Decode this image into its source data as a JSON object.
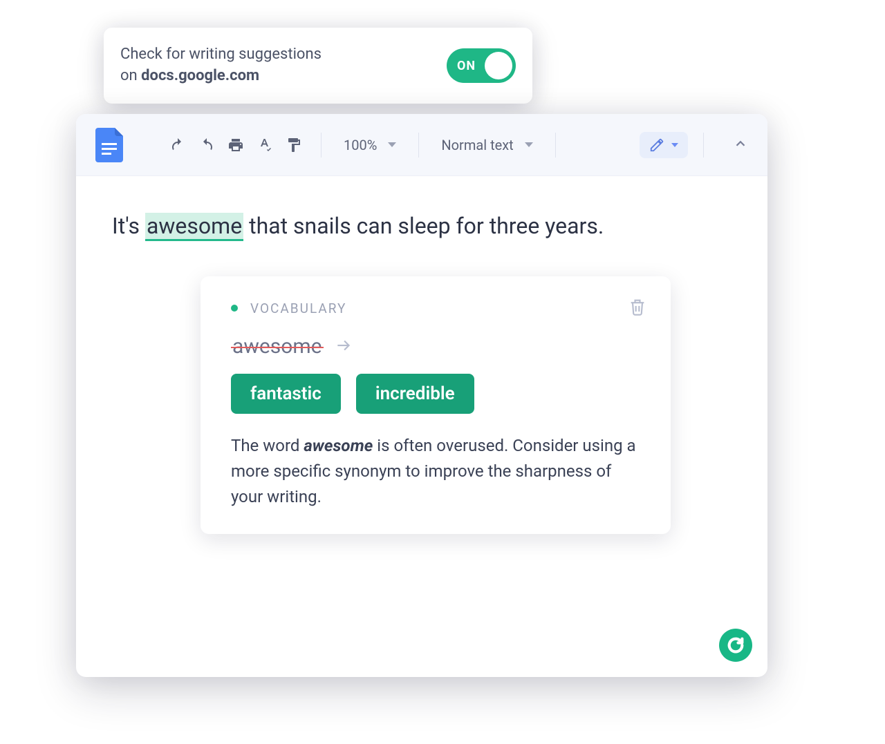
{
  "settings": {
    "text_line1": "Check for writing suggestions",
    "text_line2_prefix": "on ",
    "domain": "docs.google.com",
    "toggle_state": "ON"
  },
  "toolbar": {
    "zoom": "100%",
    "style": "Normal text"
  },
  "document": {
    "sentence_prefix": "It's ",
    "highlighted_word": "awesome",
    "sentence_suffix": " that snails can sleep for three years."
  },
  "suggestion": {
    "category": "VOCABULARY",
    "original_word": "awesome",
    "alternatives": [
      "fantastic",
      "incredible"
    ],
    "explanation_prefix": "The word ",
    "explanation_word": "awesome",
    "explanation_suffix": " is often overused. Consider using a more specific synonym to improve the sharpness of your writing."
  },
  "colors": {
    "accent_green": "#18a078",
    "toggle_green": "#1fb786"
  }
}
